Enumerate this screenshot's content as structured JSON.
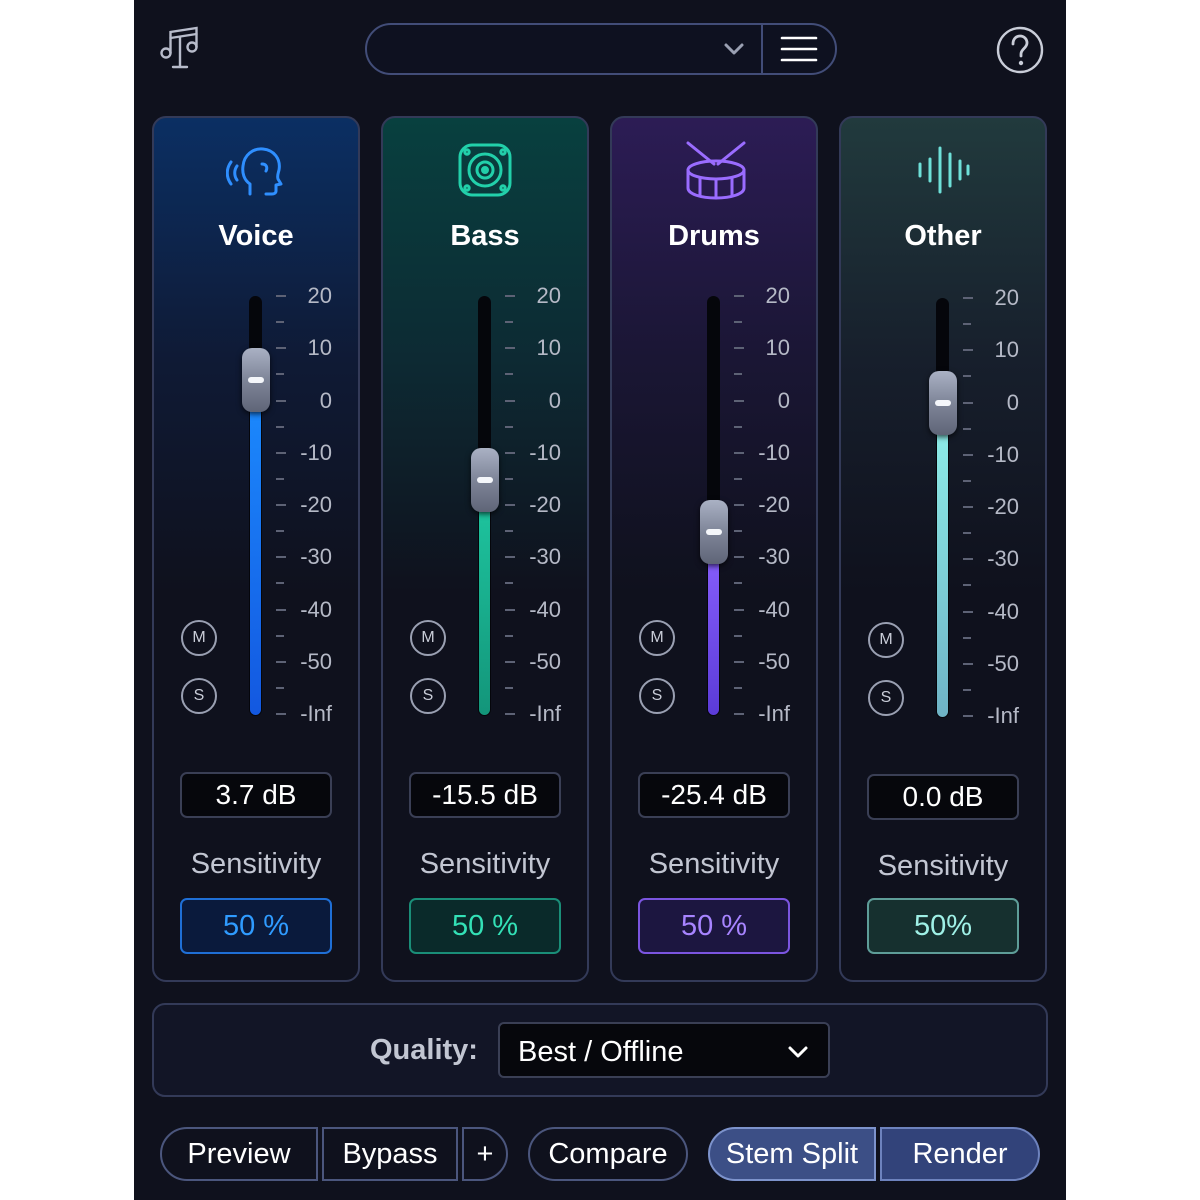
{
  "header": {
    "logo_icon": "music-notes-icon",
    "preset_value": "",
    "preset_dropdown_icon": "chevron-down-icon",
    "menu_icon": "hamburger-menu-icon",
    "help_icon": "question-mark-icon"
  },
  "scale_labels": [
    "20",
    "10",
    "0",
    "-10",
    "-20",
    "-30",
    "-40",
    "-50",
    "-Inf"
  ],
  "strips": [
    {
      "id": "voice",
      "name": "Voice",
      "icon": "voice-head-icon",
      "accent": "#1e88ff",
      "gain_label": "3.7 dB",
      "gain_level": 0.8,
      "mute": "M",
      "solo": "S",
      "sensitivity_label": "Sensitivity",
      "sensitivity_value": "50 %"
    },
    {
      "id": "bass",
      "name": "Bass",
      "icon": "speaker-icon",
      "accent": "#1fc4a0",
      "gain_label": "-15.5 dB",
      "gain_level": 0.56,
      "mute": "M",
      "solo": "S",
      "sensitivity_label": "Sensitivity",
      "sensitivity_value": "50 %"
    },
    {
      "id": "drums",
      "name": "Drums",
      "icon": "drum-icon",
      "accent": "#8a5cf6",
      "gain_label": "-25.4 dB",
      "gain_level": 0.435,
      "mute": "M",
      "solo": "S",
      "sensitivity_label": "Sensitivity",
      "sensitivity_value": "50 %"
    },
    {
      "id": "other",
      "name": "Other",
      "icon": "waveform-icon",
      "accent": "#6ee0d8",
      "gain_label": "0.0 dB",
      "gain_level": 0.75,
      "mute": "M",
      "solo": "S",
      "sensitivity_label": "Sensitivity",
      "sensitivity_value": "50%"
    }
  ],
  "quality": {
    "label": "Quality:",
    "value": "Best / Offline",
    "dropdown_icon": "chevron-down-icon"
  },
  "footer": {
    "preview": "Preview",
    "bypass": "Bypass",
    "add": "+",
    "compare": "Compare",
    "stem_split": "Stem Split",
    "render": "Render"
  }
}
